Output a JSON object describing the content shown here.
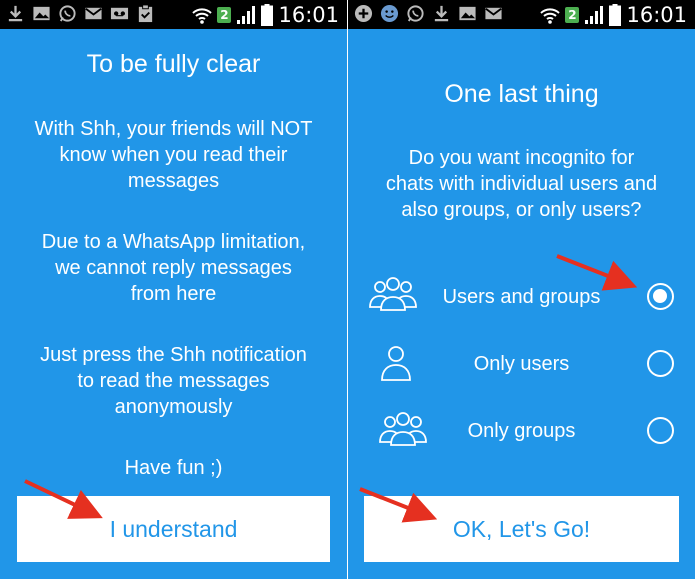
{
  "left": {
    "status_bar": {
      "icons": [
        "download-icon",
        "image-icon",
        "whatsapp-icon",
        "gmail-icon",
        "voicemail-icon",
        "clipboard-icon"
      ],
      "wifi_badge": "2",
      "time": "16:01"
    },
    "title": "To be fully clear",
    "paragraph_1": "With Shh, your friends will NOT\nknow when you read their\nmessages",
    "paragraph_2": "Due to a WhatsApp limitation,\nwe cannot reply messages\nfrom here",
    "paragraph_3": "Just press the Shh notification\nto read the messages\nanonymously",
    "paragraph_4": "Have fun ;)",
    "button_label": "I understand"
  },
  "right": {
    "status_bar": {
      "icons": [
        "add-icon",
        "smiley-icon",
        "whatsapp-icon",
        "download-icon",
        "image-icon",
        "gmail-icon"
      ],
      "wifi_badge": "2",
      "time": "16:01"
    },
    "title": "One last thing",
    "question": "Do you want incognito for\nchats with individual users and\nalso groups, or only users?",
    "options": [
      {
        "label": "Users and groups",
        "icon": "group-icon",
        "selected": true
      },
      {
        "label": "Only users",
        "icon": "user-icon",
        "selected": false
      },
      {
        "label": "Only groups",
        "icon": "group-icon",
        "selected": false
      }
    ],
    "button_label": "OK, Let's Go!"
  },
  "colors": {
    "background": "#2196e8",
    "button_text": "#2196e8",
    "arrow": "#e53020"
  }
}
